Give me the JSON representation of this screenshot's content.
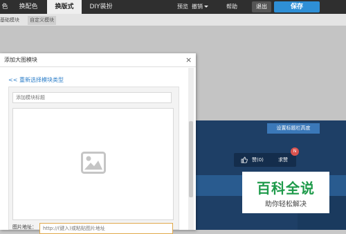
{
  "tabs": [
    {
      "label": "色"
    },
    {
      "label": "换配色"
    },
    {
      "label": "换版式"
    },
    {
      "label": "DIY装扮"
    }
  ],
  "toolbar": {
    "preview_label": "预览",
    "pageview_label": "撤销",
    "help_label": "帮助",
    "exit_label": "退出",
    "save_label": "保存"
  },
  "subtabs": {
    "basic_label": "基础模块",
    "custom_label": "自定义模块"
  },
  "dialog": {
    "title": "添加大图模块",
    "close_glyph": "×",
    "back_link": "<< 重新选择模块类型",
    "title_placeholder": "添加模块标题",
    "image_address_label": "图片地址：",
    "image_address_placeholder": "http://(键入)或粘贴图片地址"
  },
  "canvas": {
    "settings_button": "设置标题栏高度",
    "like_label": "赞(0)",
    "ask_label": "求赞",
    "badge": "N"
  },
  "watermark": {
    "big_text": "百科全说",
    "small_text": "助你轻松解决"
  },
  "colors": {
    "topbar": "#2f2f2f",
    "save_button": "#2e8fd6",
    "link": "#2e7fc9",
    "canvas_dark": "#1e3f66",
    "watermark_green": "#1e9a4a"
  },
  "icons": [
    "image-placeholder-icon",
    "thumbs-up-icon",
    "close-icon",
    "dropdown-caret-icon"
  ]
}
